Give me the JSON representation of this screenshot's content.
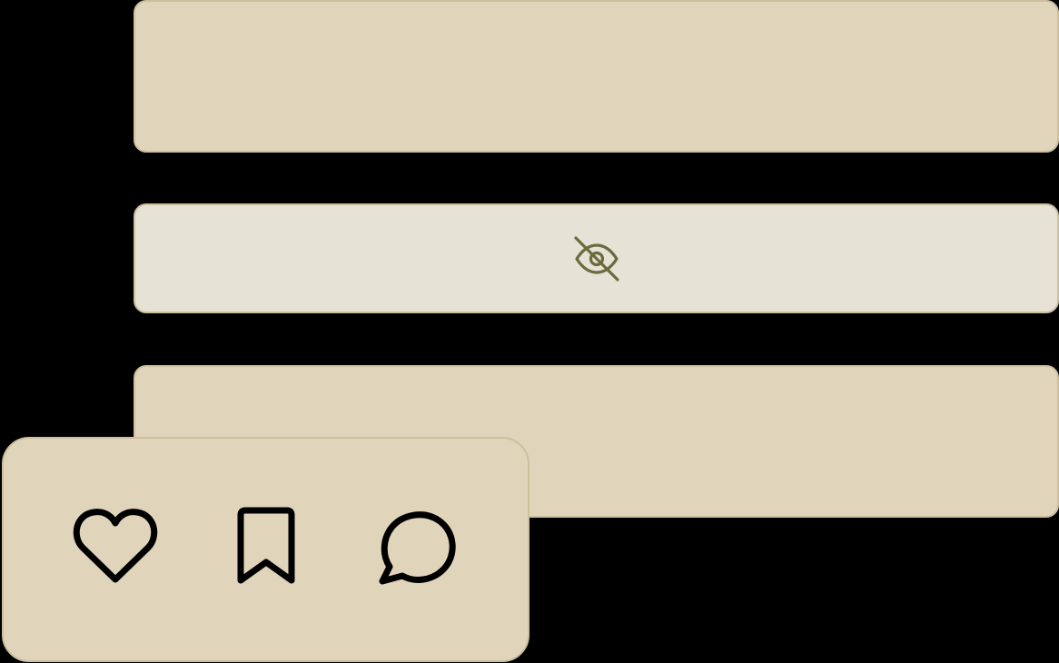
{
  "cards": [
    {
      "name": "content-card-1",
      "state": "visible"
    },
    {
      "name": "content-card-2",
      "state": "hidden",
      "icon": "eye-off-icon"
    },
    {
      "name": "content-card-3",
      "state": "visible"
    }
  ],
  "action_bar": {
    "buttons": [
      {
        "name": "like-button",
        "icon": "heart-icon"
      },
      {
        "name": "save-button",
        "icon": "bookmark-icon"
      },
      {
        "name": "comment-button",
        "icon": "speech-bubble-icon"
      }
    ]
  },
  "colors": {
    "background": "#000000",
    "card_fill": "#e0d4ba",
    "card_border": "#cdbf9d",
    "hidden_card_fill": "#e6e2d6",
    "hidden_icon": "#6b6b3e",
    "action_icon": "#000000"
  }
}
